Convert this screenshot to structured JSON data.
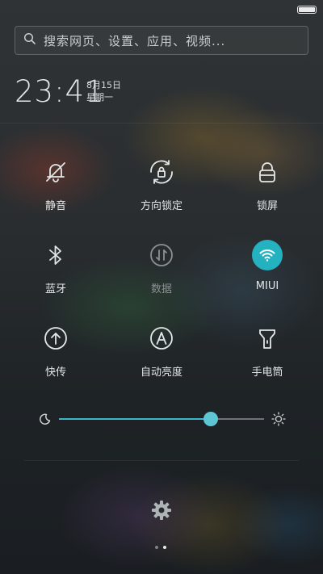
{
  "status_bar": {
    "battery_icon": "battery-full-icon"
  },
  "search": {
    "icon": "search-icon",
    "placeholder": "搜索网页、设置、应用、视频..."
  },
  "clock": {
    "time": "23:41",
    "date": "8月15日",
    "weekday": "星期一"
  },
  "toggles": [
    {
      "label": "静音",
      "icon": "bell-off-icon",
      "state": "off"
    },
    {
      "label": "方向锁定",
      "icon": "rotation-lock-icon",
      "state": "off"
    },
    {
      "label": "锁屏",
      "icon": "lock-icon",
      "state": "off"
    },
    {
      "label": "蓝牙",
      "icon": "bluetooth-icon",
      "state": "off"
    },
    {
      "label": "数据",
      "icon": "mobile-data-icon",
      "state": "disabled"
    },
    {
      "label": "MIUI",
      "icon": "wifi-icon",
      "state": "on"
    },
    {
      "label": "快传",
      "icon": "upload-arrow-icon",
      "state": "off"
    },
    {
      "label": "自动亮度",
      "icon": "auto-brightness-icon",
      "state": "off"
    },
    {
      "label": "手电筒",
      "icon": "flashlight-icon",
      "state": "off"
    }
  ],
  "brightness": {
    "level": 0.74,
    "min_icon": "moon-icon",
    "max_icon": "sun-icon"
  },
  "settings": {
    "icon": "gear-icon"
  },
  "pager": {
    "pages": 2,
    "current": 2
  },
  "colors": {
    "accent": "#24b2c0"
  }
}
